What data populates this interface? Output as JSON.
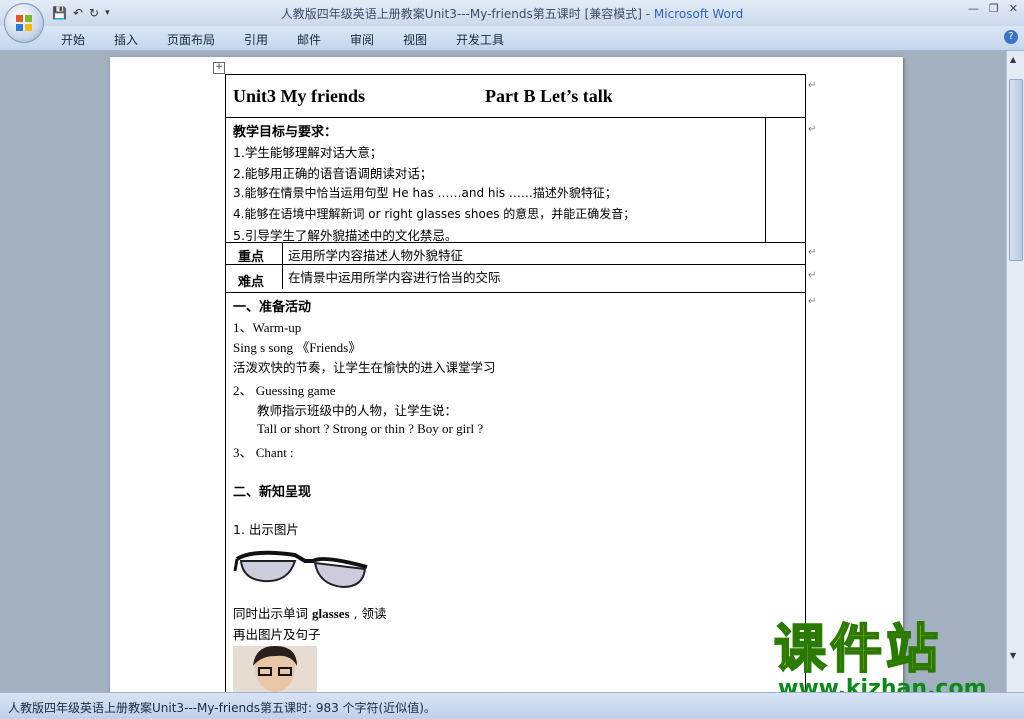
{
  "window": {
    "title": "人教版四年级英语上册教案Unit3---My-friends第五课时 [兼容模式] - ",
    "app_name": "Microsoft Word"
  },
  "ribbon": {
    "tabs": [
      "开始",
      "插入",
      "页面布局",
      "引用",
      "邮件",
      "审阅",
      "视图",
      "开发工具"
    ]
  },
  "doc": {
    "header_left": "Unit3 My friends",
    "header_right": "Part B    Let’s talk",
    "goals_title": "教学目标与要求：",
    "goals": [
      "1.学生能够理解对话大意；",
      "2.能够用正确的语音语调朗读对话；",
      "3.能够在情景中恰当运用句型 He has ……and his ……描述外貌特征；",
      "4.能够在语境中理解新词 or right glasses shoes 的意思，并能正确发音；",
      "5.引导学生了解外貌描述中的文化禁忌。"
    ],
    "key_label": "重点",
    "key_text": "运用所学内容描述人物外貌特征",
    "difficulty_label": "难点",
    "difficulty_text": "在情景中运用所学内容进行恰当的交际",
    "section1_title": "一、准备活动",
    "warmup": "1、Warm-up",
    "song": "Sing s song 《Friends》",
    "song_note": "活泼欢快的节奏，让学生在愉快的进入课堂学习",
    "guessing": "2、 Guessing game",
    "guessing_note": "教师指示班级中的人物，让学生说：",
    "guessing_questions": "Tall or short ?    Strong or thin ?     Boy or girl ?",
    "chant": "3、 Chant :",
    "section2_title": "二、新知呈现",
    "show_picture": "1.   出示图片",
    "glasses_prefix": "同时出示单词 ",
    "glasses_word": "glasses",
    "glasses_suffix": " , 领读",
    "show_again": "再出图片及句子"
  },
  "status_bar": {
    "text": "人教版四年级英语上册教案Unit3---My-friends第五课时: 983 个字符(近似值)。"
  },
  "watermark": {
    "cn": "课件站",
    "url": "www.kjzhan.com"
  }
}
